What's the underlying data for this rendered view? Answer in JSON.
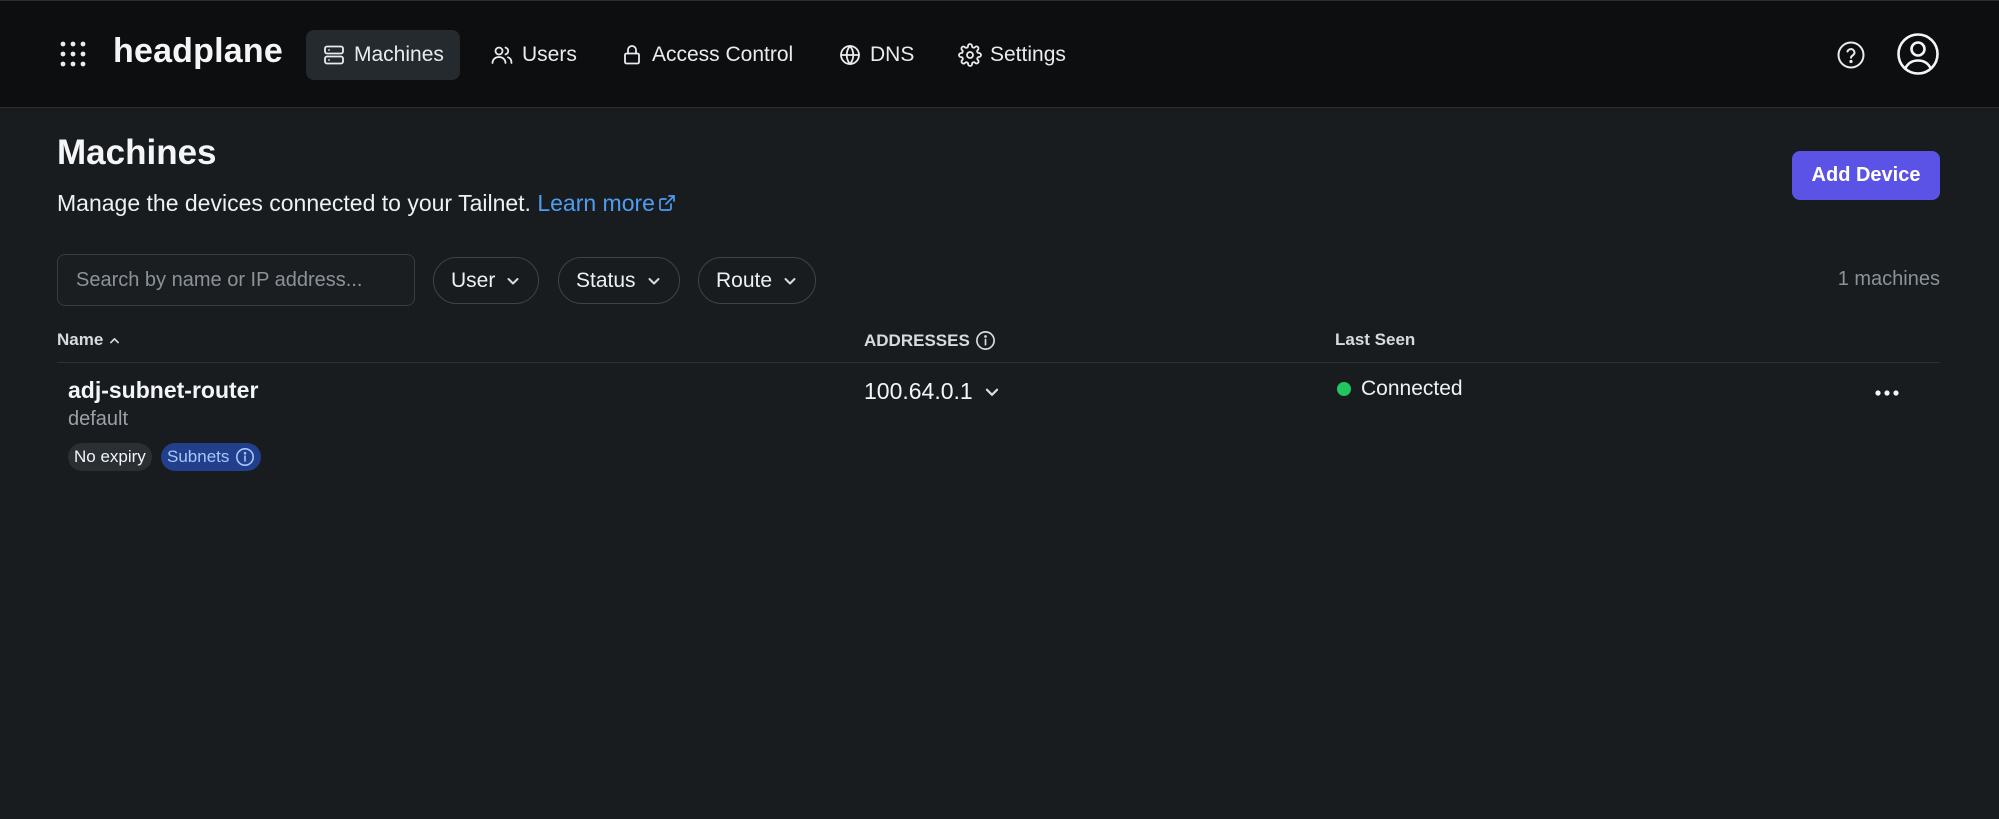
{
  "header": {
    "brand": "headplane",
    "nav": [
      {
        "label": "Machines",
        "icon": "server-icon",
        "active": true
      },
      {
        "label": "Users",
        "icon": "users-icon",
        "active": false
      },
      {
        "label": "Access Control",
        "icon": "lock-icon",
        "active": false
      },
      {
        "label": "DNS",
        "icon": "globe-icon",
        "active": false
      },
      {
        "label": "Settings",
        "icon": "gear-icon",
        "active": false
      }
    ]
  },
  "page": {
    "title": "Machines",
    "subtitle": "Manage the devices connected to your Tailnet.",
    "learn_more": "Learn more",
    "add_button": "Add Device"
  },
  "filters": {
    "search_placeholder": "Search by name or IP address...",
    "user": "User",
    "status": "Status",
    "route": "Route",
    "count": "1 machines"
  },
  "table": {
    "headers": {
      "name": "Name",
      "addresses": "ADDRESSES",
      "last_seen": "Last Seen"
    },
    "rows": [
      {
        "name": "adj-subnet-router",
        "user": "default",
        "badges": [
          "No expiry",
          "Subnets"
        ],
        "address": "100.64.0.1",
        "status": "Connected"
      }
    ]
  },
  "colors": {
    "accent": "#5b52e6",
    "link": "#4f9cf0",
    "online": "#22c55e",
    "background": "#181c1f",
    "topbar": "#0c0e10"
  }
}
